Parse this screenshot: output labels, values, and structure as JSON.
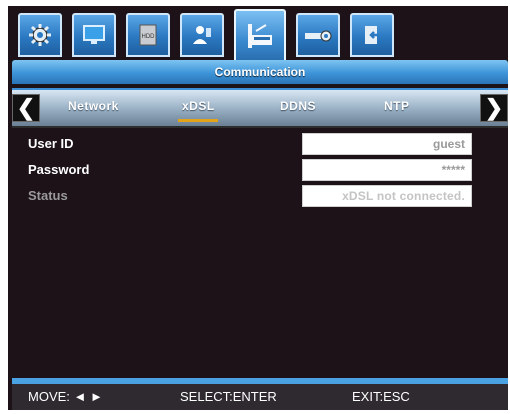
{
  "tabs": [
    {
      "icon": "gear-icon",
      "active": false
    },
    {
      "icon": "monitor-icon",
      "active": false
    },
    {
      "icon": "hdd-icon",
      "active": false
    },
    {
      "icon": "user-icon",
      "active": false
    },
    {
      "icon": "network-icon",
      "active": true
    },
    {
      "icon": "device-settings-icon",
      "active": false
    },
    {
      "icon": "exit-icon",
      "active": false
    }
  ],
  "section_title": "Communication",
  "subtabs": {
    "items": [
      "Network",
      "xDSL",
      "DDNS",
      "NTP"
    ],
    "active_index": 1
  },
  "form": {
    "user_id_label": "User ID",
    "user_id_value": "guest",
    "password_label": "Password",
    "password_value": "*****",
    "status_label": "Status",
    "status_value": "xDSL not connected."
  },
  "footer": {
    "move": "MOVE: ◄ ►",
    "select": "SELECT:ENTER",
    "exit": "EXIT:ESC"
  },
  "colors": {
    "accent_blue": "#3d94d8",
    "active_underline": "#e2a21a",
    "panel_bg": "#1c1218"
  }
}
